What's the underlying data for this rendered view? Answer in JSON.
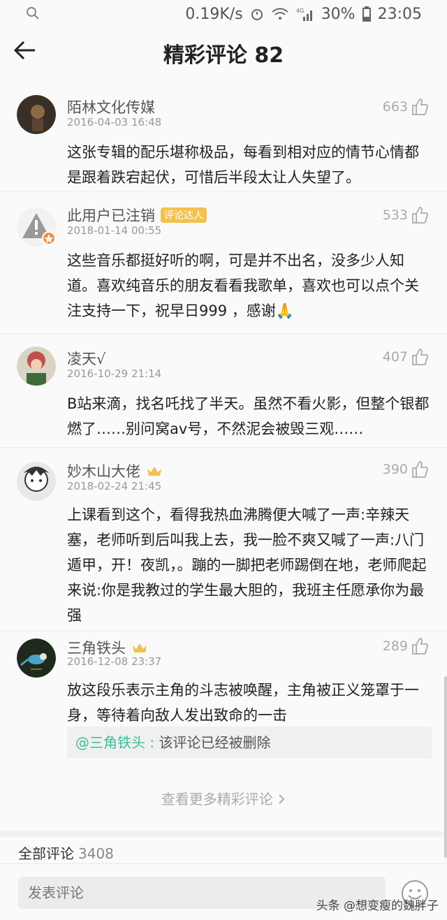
{
  "status_bar": {
    "speed": "0.19K/s",
    "battery": "30%",
    "time": "23:05",
    "network": "4G"
  },
  "header": {
    "title": "精彩评论 82"
  },
  "comments": [
    {
      "name": "陌林文化传媒",
      "date": "2016-04-03 16:48",
      "likes": "663",
      "text": "这张专辑的配乐堪称极品，每看到相对应的情节心情都是跟着跌宕起伏，可惜后半段太让人失望了。"
    },
    {
      "name": "此用户已注销",
      "badge": "评论达人",
      "date": "2018-01-14 00:55",
      "likes": "533",
      "text": "这些音乐都挺好听的啊，可是并不出名，没多少人知道。喜欢纯音乐的朋友看看我歌单，喜欢也可以点个关注支持一下，祝早日999 ，感谢🙏"
    },
    {
      "name": "凌天√",
      "date": "2016-10-29 21:14",
      "likes": "407",
      "text": "B站来滴，找名吒找了半天。虽然不看火影，但整个银都燃了……别问窝av号，不然泥会被毁三观……"
    },
    {
      "name": "妙木山大佬",
      "date": "2018-02-24 21:45",
      "likes": "390",
      "text": "上课看到这个，看得我热血沸腾便大喊了一声:辛辣天塞，老师听到后叫我上去，我一脸不爽又喊了一声:八门遁甲，开！夜凯，。蹦的一脚把老师踢倒在地，老师爬起来说:你是我教过的学生最大胆的，我班主任愿承你为最强"
    },
    {
      "name": "三角铁头",
      "date": "2016-12-08 23:37",
      "likes": "289",
      "text": "放这段乐表示主角的斗志被唤醒，主角被正义笼罩于一身，等待着向敌人发出致命的一击",
      "reply": {
        "author": "@三角铁头 :",
        "text": " 该评论已经被删除"
      }
    }
  ],
  "more_link": "查看更多精彩评论",
  "all_comments": {
    "label": "全部评论",
    "count": "3408"
  },
  "input": {
    "placeholder": "发表评论"
  },
  "watermark": "头条 @想变瘦的魏胖子",
  "colors": {
    "accent": "#3dbd9a",
    "badge": "#f2c14e"
  }
}
